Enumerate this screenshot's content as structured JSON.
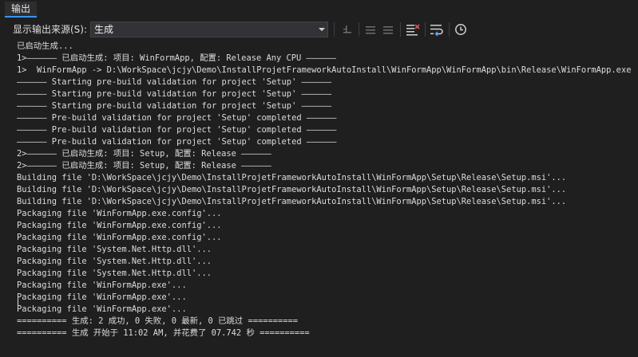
{
  "panel": {
    "title": "输出"
  },
  "toolbar": {
    "source_label": "显示输出来源(S):",
    "source_value": "生成",
    "icons": [
      "find-prev-icon",
      "go-prev-icon",
      "go-next-icon",
      "clear-all-icon",
      "word-wrap-icon",
      "clock-icon"
    ]
  },
  "output": {
    "lines": [
      "已启动生成...",
      "1>—————— 已启动生成: 项目: WinFormApp, 配置: Release Any CPU ——————",
      "1>  WinFormApp -> D:\\WorkSpace\\jcjy\\Demo\\InstallProjetFrameworkAutoInstall\\WinFormApp\\WinFormApp\\bin\\Release\\WinFormApp.exe",
      "—————— Starting pre-build validation for project 'Setup' ——————",
      "—————— Starting pre-build validation for project 'Setup' ——————",
      "—————— Starting pre-build validation for project 'Setup' ——————",
      "—————— Pre-build validation for project 'Setup' completed ——————",
      "—————— Pre-build validation for project 'Setup' completed ——————",
      "—————— Pre-build validation for project 'Setup' completed ——————",
      "2>—————— 已启动生成: 项目: Setup, 配置: Release ——————",
      "2>—————— 已启动生成: 项目: Setup, 配置: Release ——————",
      "Building file 'D:\\WorkSpace\\jcjy\\Demo\\InstallProjetFrameworkAutoInstall\\WinFormApp\\Setup\\Release\\Setup.msi'...",
      "Building file 'D:\\WorkSpace\\jcjy\\Demo\\InstallProjetFrameworkAutoInstall\\WinFormApp\\Setup\\Release\\Setup.msi'...",
      "Building file 'D:\\WorkSpace\\jcjy\\Demo\\InstallProjetFrameworkAutoInstall\\WinFormApp\\Setup\\Release\\Setup.msi'...",
      "Packaging file 'WinFormApp.exe.config'...",
      "Packaging file 'WinFormApp.exe.config'...",
      "Packaging file 'WinFormApp.exe.config'...",
      "Packaging file 'System.Net.Http.dll'...",
      "Packaging file 'System.Net.Http.dll'...",
      "Packaging file 'System.Net.Http.dll'...",
      "Packaging file 'WinFormApp.exe'...",
      "Packaging file 'WinFormApp.exe'...",
      "Packaging file 'WinFormApp.exe'...",
      "========== 生成: 2 成功, 0 失败, 0 最新, 0 已跳过 ==========",
      "========== 生成 开始于 11:02 AM, 并花费了 07.742 秒 =========="
    ]
  }
}
